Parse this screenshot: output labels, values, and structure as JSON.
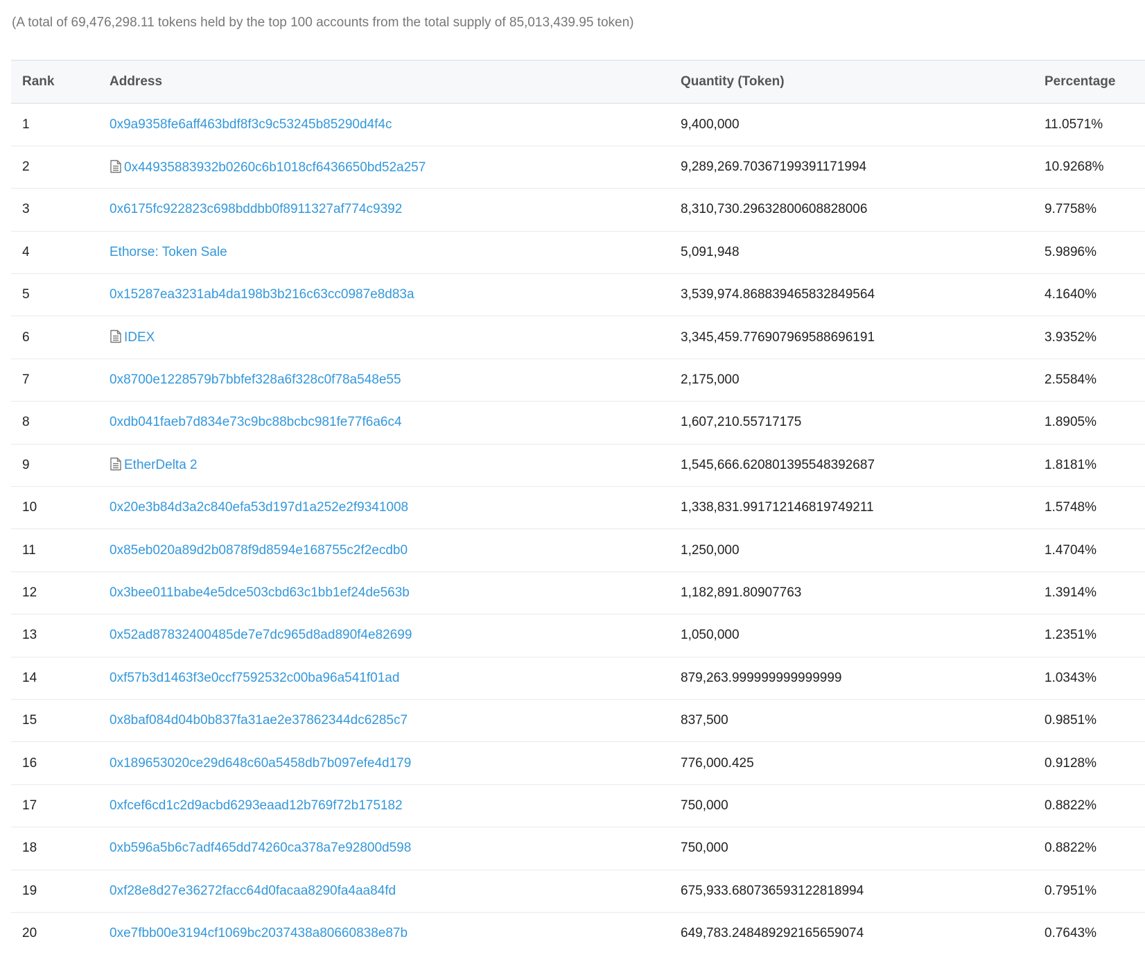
{
  "summary": "(A total of 69,476,298.11 tokens held by the top 100 accounts from the total supply of 85,013,439.95 token)",
  "table": {
    "headers": {
      "rank": "Rank",
      "address": "Address",
      "quantity": "Quantity (Token)",
      "percentage": "Percentage"
    },
    "rows": [
      {
        "rank": "1",
        "address": "0x9a9358fe6aff463bdf8f3c9c53245b85290d4f4c",
        "contract": false,
        "quantity": "9,400,000",
        "percentage": "11.0571%"
      },
      {
        "rank": "2",
        "address": "0x44935883932b0260c6b1018cf6436650bd52a257",
        "contract": true,
        "quantity": "9,289,269.70367199391171994",
        "percentage": "10.9268%"
      },
      {
        "rank": "3",
        "address": "0x6175fc922823c698bddbb0f8911327af774c9392",
        "contract": false,
        "quantity": "8,310,730.29632800608828006",
        "percentage": "9.7758%"
      },
      {
        "rank": "4",
        "address": "Ethorse: Token Sale",
        "contract": false,
        "quantity": "5,091,948",
        "percentage": "5.9896%"
      },
      {
        "rank": "5",
        "address": "0x15287ea3231ab4da198b3b216c63cc0987e8d83a",
        "contract": false,
        "quantity": "3,539,974.868839465832849564",
        "percentage": "4.1640%"
      },
      {
        "rank": "6",
        "address": "IDEX",
        "contract": true,
        "quantity": "3,345,459.776907969588696191",
        "percentage": "3.9352%"
      },
      {
        "rank": "7",
        "address": "0x8700e1228579b7bbfef328a6f328c0f78a548e55",
        "contract": false,
        "quantity": "2,175,000",
        "percentage": "2.5584%"
      },
      {
        "rank": "8",
        "address": "0xdb041faeb7d834e73c9bc88bcbc981fe77f6a6c4",
        "contract": false,
        "quantity": "1,607,210.55717175",
        "percentage": "1.8905%"
      },
      {
        "rank": "9",
        "address": "EtherDelta 2",
        "contract": true,
        "quantity": "1,545,666.620801395548392687",
        "percentage": "1.8181%"
      },
      {
        "rank": "10",
        "address": "0x20e3b84d3a2c840efa53d197d1a252e2f9341008",
        "contract": false,
        "quantity": "1,338,831.991712146819749211",
        "percentage": "1.5748%"
      },
      {
        "rank": "11",
        "address": "0x85eb020a89d2b0878f9d8594e168755c2f2ecdb0",
        "contract": false,
        "quantity": "1,250,000",
        "percentage": "1.4704%"
      },
      {
        "rank": "12",
        "address": "0x3bee011babe4e5dce503cbd63c1bb1ef24de563b",
        "contract": false,
        "quantity": "1,182,891.80907763",
        "percentage": "1.3914%"
      },
      {
        "rank": "13",
        "address": "0x52ad87832400485de7e7dc965d8ad890f4e82699",
        "contract": false,
        "quantity": "1,050,000",
        "percentage": "1.2351%"
      },
      {
        "rank": "14",
        "address": "0xf57b3d1463f3e0ccf7592532c00ba96a541f01ad",
        "contract": false,
        "quantity": "879,263.999999999999999",
        "percentage": "1.0343%"
      },
      {
        "rank": "15",
        "address": "0x8baf084d04b0b837fa31ae2e37862344dc6285c7",
        "contract": false,
        "quantity": "837,500",
        "percentage": "0.9851%"
      },
      {
        "rank": "16",
        "address": "0x189653020ce29d648c60a5458db7b097efe4d179",
        "contract": false,
        "quantity": "776,000.425",
        "percentage": "0.9128%"
      },
      {
        "rank": "17",
        "address": "0xfcef6cd1c2d9acbd6293eaad12b769f72b175182",
        "contract": false,
        "quantity": "750,000",
        "percentage": "0.8822%"
      },
      {
        "rank": "18",
        "address": "0xb596a5b6c7adf465dd74260ca378a7e92800d598",
        "contract": false,
        "quantity": "750,000",
        "percentage": "0.8822%"
      },
      {
        "rank": "19",
        "address": "0xf28e8d27e36272facc64d0facaa8290fa4aa84fd",
        "contract": false,
        "quantity": "675,933.680736593122818994",
        "percentage": "0.7951%"
      },
      {
        "rank": "20",
        "address": "0xe7fbb00e3194cf1069bc2037438a80660838e87b",
        "contract": false,
        "quantity": "649,783.248489292165659074",
        "percentage": "0.7643%"
      }
    ]
  },
  "icons": {
    "contract": "contract-file-icon"
  },
  "colors": {
    "link": "#3498db",
    "header_bg": "#f7f8fa",
    "border": "#e7eaf3",
    "muted_text": "#777777"
  }
}
